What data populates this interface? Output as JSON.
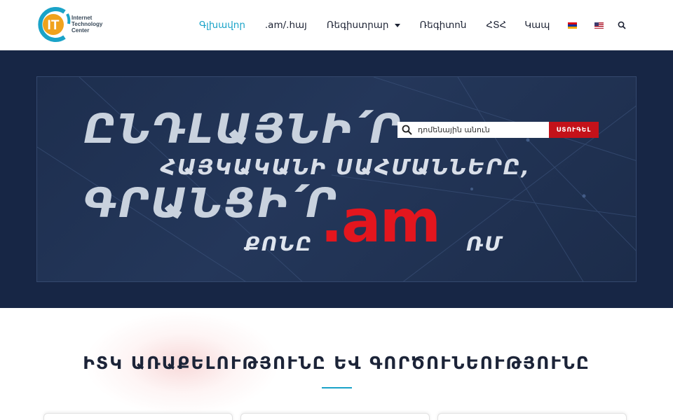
{
  "logo": {
    "mark": "IT",
    "line1": "Internet",
    "line2": "Technology",
    "line3": "Center"
  },
  "nav": {
    "items": [
      {
        "label": "Գլխավոր",
        "active": true
      },
      {
        "label": ".am/.հայ",
        "active": false
      },
      {
        "label": "Ռեգիստրար",
        "active": false,
        "has_dropdown": true
      },
      {
        "label": "Ռեգիտոն",
        "active": false
      },
      {
        "label": "ՀՏՀ",
        "active": false
      },
      {
        "label": "Կապ",
        "active": false
      }
    ],
    "languages": [
      "armenian-flag-icon",
      "us-flag-icon"
    ],
    "search_icon": "search-icon"
  },
  "hero": {
    "line1": "ԸՆԴԼԱՅՆԻ՛Ր",
    "line2": "ՀԱՅԿԱԿԱՆԻ ՍԱՀՄԱՆՆԵՐԸ,",
    "line3": "ԳՐԱՆՑԻ՛Ր",
    "domain": ".am",
    "line4a": "ՔՈՆԸ",
    "line4b": "ՌՄ",
    "search": {
      "value": "դոմենային անուն",
      "button_label": "ՍՏՈՒԳԵԼ"
    }
  },
  "section": {
    "title": "ԻՏԿ ԱՌԱՔԵԼՈՒԹՅՈՒՆԸ ԵՎ ԳՈՐԾՈՒՆԵՈՒԹՅՈՒՆԸ"
  },
  "colors": {
    "accent": "#1aa3c8",
    "hero_bg": "#172645",
    "brand_red": "#e3161e",
    "button_red": "#c4121a",
    "logo_orange": "#f0a21c",
    "logo_blue": "#1aa3c8"
  }
}
